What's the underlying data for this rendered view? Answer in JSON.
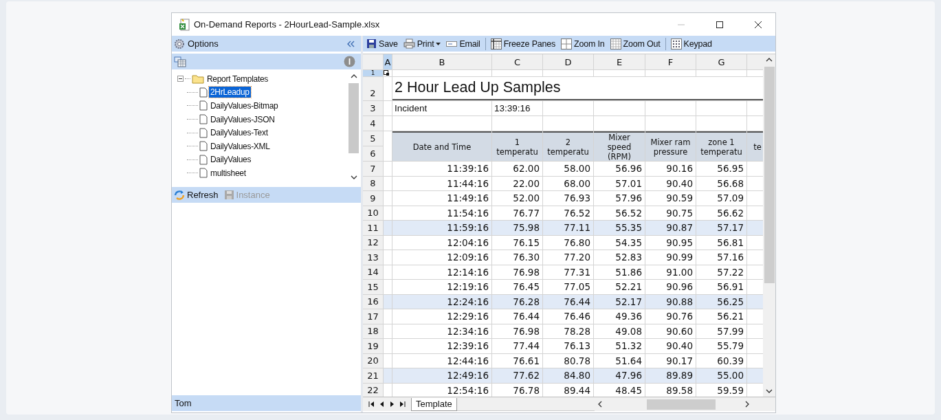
{
  "window": {
    "title": "On-Demand Reports - 2HourLead-Sample.xlsx"
  },
  "options_panel": {
    "title": "Options"
  },
  "tree": {
    "label": "Report Templates",
    "expanded": true,
    "children": [
      {
        "label": "2HrLeadup",
        "selected": true
      },
      {
        "label": "DailyValues-Bitmap",
        "selected": false
      },
      {
        "label": "DailyValues-JSON",
        "selected": false
      },
      {
        "label": "DailyValues-Text",
        "selected": false
      },
      {
        "label": "DailyValues-XML",
        "selected": false
      },
      {
        "label": "DailyValues",
        "selected": false
      },
      {
        "label": "multisheet",
        "selected": false
      }
    ]
  },
  "actions": [
    {
      "label": "Refresh",
      "kind": "refresh",
      "disabled": false
    },
    {
      "label": "Instance",
      "kind": "instance",
      "disabled": true
    }
  ],
  "user": "Tom",
  "toolbar": [
    [
      {
        "label": "Save",
        "kind": "save",
        "dropdown": false
      },
      {
        "label": "Print",
        "kind": "print",
        "dropdown": true
      },
      {
        "label": "Email",
        "kind": "email",
        "dropdown": false
      }
    ],
    [
      {
        "label": "Freeze Panes",
        "kind": "freeze",
        "dropdown": false
      },
      {
        "label": "Zoom In",
        "kind": "zoomin",
        "dropdown": false
      },
      {
        "label": "Zoom Out",
        "kind": "zoomout",
        "dropdown": false
      }
    ],
    [
      {
        "label": "Keypad",
        "kind": "keypad",
        "dropdown": false
      }
    ]
  ],
  "sheet": {
    "columns": [
      {
        "letter": "A",
        "selected": true
      },
      {
        "letter": "B",
        "selected": false
      },
      {
        "letter": "C",
        "selected": false
      },
      {
        "letter": "D",
        "selected": false
      },
      {
        "letter": "E",
        "selected": false
      },
      {
        "letter": "F",
        "selected": false
      },
      {
        "letter": "G",
        "selected": false
      }
    ],
    "top_rows": [
      {
        "number": "1",
        "selected": true
      },
      {
        "number": "2",
        "selected": false
      },
      {
        "number": "3",
        "selected": false
      },
      {
        "number": "4",
        "selected": false
      },
      {
        "number": "5",
        "selected": false
      },
      {
        "number": "6",
        "selected": false
      }
    ],
    "title": "2 Hour Lead Up Samples",
    "incident": {
      "label": "Incident",
      "value": "13:39:16"
    },
    "headers": [
      "Date and Time",
      "1\ntemperatu",
      "2\ntemperatu",
      "Mixer\nspeed\n(RPM)",
      "Mixer ram\npressure",
      "zone 1\ntemperatu",
      "te"
    ],
    "rows": [
      {
        "number": "7",
        "banded": false,
        "cells": [
          "",
          "11:39:16",
          "62.00",
          "58.00",
          "56.96",
          "90.16",
          "56.95"
        ]
      },
      {
        "number": "8",
        "banded": false,
        "cells": [
          "",
          "11:44:16",
          "22.00",
          "68.00",
          "57.01",
          "90.40",
          "56.68"
        ]
      },
      {
        "number": "9",
        "banded": false,
        "cells": [
          "",
          "11:49:16",
          "52.00",
          "76.93",
          "57.96",
          "90.59",
          "57.09"
        ]
      },
      {
        "number": "10",
        "banded": false,
        "cells": [
          "",
          "11:54:16",
          "76.77",
          "76.52",
          "56.52",
          "90.75",
          "56.62"
        ]
      },
      {
        "number": "11",
        "banded": true,
        "cells": [
          "",
          "11:59:16",
          "75.98",
          "77.11",
          "55.35",
          "90.87",
          "57.17"
        ]
      },
      {
        "number": "12",
        "banded": false,
        "cells": [
          "",
          "12:04:16",
          "76.15",
          "76.80",
          "54.35",
          "90.95",
          "56.81"
        ]
      },
      {
        "number": "13",
        "banded": false,
        "cells": [
          "",
          "12:09:16",
          "76.30",
          "77.20",
          "52.83",
          "90.99",
          "57.16"
        ]
      },
      {
        "number": "14",
        "banded": false,
        "cells": [
          "",
          "12:14:16",
          "76.98",
          "77.31",
          "51.86",
          "91.00",
          "57.22"
        ]
      },
      {
        "number": "15",
        "banded": false,
        "cells": [
          "",
          "12:19:16",
          "76.45",
          "77.05",
          "52.21",
          "90.96",
          "56.91"
        ]
      },
      {
        "number": "16",
        "banded": true,
        "cells": [
          "",
          "12:24:16",
          "76.28",
          "76.44",
          "52.17",
          "90.88",
          "56.25"
        ]
      },
      {
        "number": "17",
        "banded": false,
        "cells": [
          "",
          "12:29:16",
          "76.44",
          "76.46",
          "49.36",
          "90.76",
          "56.21"
        ]
      },
      {
        "number": "18",
        "banded": false,
        "cells": [
          "",
          "12:34:16",
          "76.98",
          "78.28",
          "49.08",
          "90.60",
          "57.99"
        ]
      },
      {
        "number": "19",
        "banded": false,
        "cells": [
          "",
          "12:39:16",
          "77.44",
          "76.13",
          "51.32",
          "90.40",
          "55.79"
        ]
      },
      {
        "number": "20",
        "banded": false,
        "cells": [
          "",
          "12:44:16",
          "76.61",
          "80.78",
          "51.64",
          "90.17",
          "60.39"
        ]
      },
      {
        "number": "21",
        "banded": true,
        "cells": [
          "",
          "12:49:16",
          "77.62",
          "84.80",
          "47.96",
          "89.89",
          "55.00"
        ]
      },
      {
        "number": "22",
        "banded": false,
        "cells": [
          "",
          "12:54:16",
          "76.78",
          "89.44",
          "48.45",
          "89.58",
          "59.59"
        ]
      }
    ]
  },
  "sheet_tabs": [
    {
      "label": "Template",
      "selected": true
    }
  ]
}
